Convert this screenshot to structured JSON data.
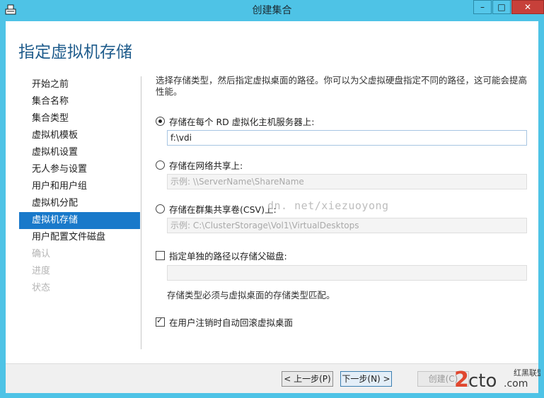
{
  "window": {
    "title": "创建集合",
    "controls": {
      "minimize": "–",
      "maximize": "□",
      "close": "✕"
    }
  },
  "page": {
    "heading": "指定虚拟机存储"
  },
  "nav": {
    "items": [
      {
        "label": "开始之前",
        "state": "normal"
      },
      {
        "label": "集合名称",
        "state": "normal"
      },
      {
        "label": "集合类型",
        "state": "normal"
      },
      {
        "label": "虚拟机模板",
        "state": "normal"
      },
      {
        "label": "虚拟机设置",
        "state": "normal"
      },
      {
        "label": "无人参与设置",
        "state": "normal"
      },
      {
        "label": "用户和用户组",
        "state": "normal"
      },
      {
        "label": "虚拟机分配",
        "state": "normal"
      },
      {
        "label": "虚拟机存储",
        "state": "active"
      },
      {
        "label": "用户配置文件磁盘",
        "state": "normal"
      },
      {
        "label": "确认",
        "state": "disabled"
      },
      {
        "label": "进度",
        "state": "disabled"
      },
      {
        "label": "状态",
        "state": "disabled"
      }
    ]
  },
  "content": {
    "intro": "选择存储类型，然后指定虚拟桌面的路径。你可以为父虚拟硬盘指定不同的路径，这可能会提高性能。",
    "option_local": {
      "label": "存储在每个 RD 虚拟化主机服务器上:",
      "checked": true,
      "value": "f:\\vdi"
    },
    "option_share": {
      "label": "存储在网络共享上:",
      "checked": false,
      "placeholder": "示例: \\\\ServerName\\ShareName"
    },
    "option_csv": {
      "label": "存储在群集共享卷(CSV)上:",
      "checked": false,
      "placeholder": "示例: C:\\ClusterStorage\\Vol1\\VirtualDesktops"
    },
    "option_parent": {
      "label": "指定单独的路径以存储父磁盘:",
      "checked": false,
      "value": ""
    },
    "parent_note": "存储类型必须与虚拟桌面的存储类型匹配。",
    "option_rollback": {
      "label": "在用户注销时自动回滚虚拟桌面",
      "checked": true
    },
    "watermark": "dn. net/xiezuoyong"
  },
  "footer": {
    "back": "< 上一步(P)",
    "next": "下一步(N) >",
    "create": "创建(C)"
  },
  "colors": {
    "titlebar": "#4ec3e6",
    "accent": "#1979ca",
    "heading": "#1f5c8c"
  }
}
